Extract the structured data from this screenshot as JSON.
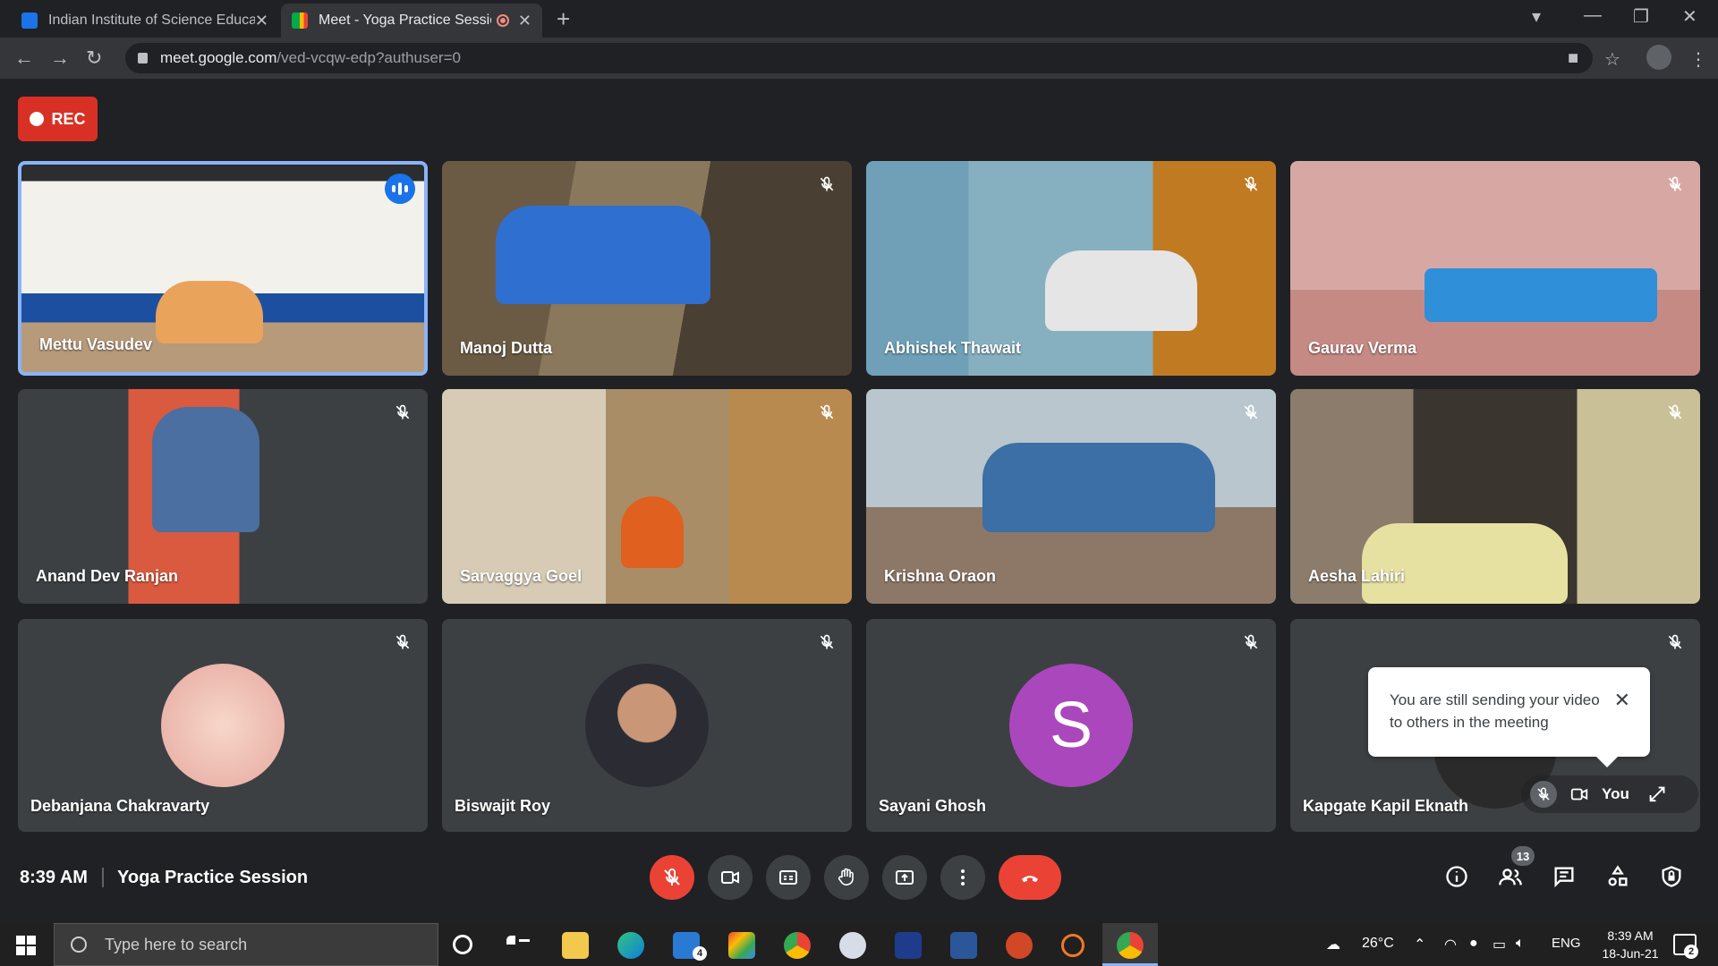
{
  "browser": {
    "tabs": [
      {
        "title": "Indian Institute of Science Education",
        "favicon_color": "#1a73e8"
      },
      {
        "title": "Meet - Yoga Practice Session",
        "favicon_color": "#00ac47"
      }
    ],
    "url_host": "meet.google.com",
    "url_path": "/ved-vcqw-edp?authuser=0"
  },
  "recording": {
    "label": "REC"
  },
  "participants": [
    {
      "name": "Mettu Vasudev",
      "mic": "speaking"
    },
    {
      "name": "Manoj Dutta",
      "mic": "muted"
    },
    {
      "name": "Abhishek Thawait",
      "mic": "muted"
    },
    {
      "name": "Gaurav Verma",
      "mic": "muted"
    },
    {
      "name": "Anand Dev Ranjan",
      "mic": "muted"
    },
    {
      "name": "Sarvaggya Goel",
      "mic": "muted"
    },
    {
      "name": "Krishna Oraon",
      "mic": "muted"
    },
    {
      "name": "Aesha Lahiri",
      "mic": "muted"
    },
    {
      "name": "Debanjana Chakravarty",
      "mic": "muted"
    },
    {
      "name": "Biswajit Roy",
      "mic": "muted"
    },
    {
      "name": "Sayani Ghosh",
      "mic": "muted",
      "avatar_letter": "S"
    },
    {
      "name": "Kapgate Kapil Eknath",
      "mic": "muted"
    }
  ],
  "tooltip": {
    "text": "You are still sending your video to others in the meeting"
  },
  "self_view": {
    "label": "You"
  },
  "meeting": {
    "time": "8:39 AM",
    "title": "Yoga Practice Session",
    "participant_count": "13"
  },
  "taskbar": {
    "search_placeholder": "Type here to search",
    "mail_badge": "4",
    "weather": "26°C",
    "language": "ENG",
    "time": "8:39 AM",
    "date": "18-Jun-21",
    "notification_count": "2"
  },
  "colors": {
    "accent": "#8ab4f8",
    "danger": "#ea4335",
    "rec": "#d93025",
    "avatar_s": "#ab47bc"
  }
}
